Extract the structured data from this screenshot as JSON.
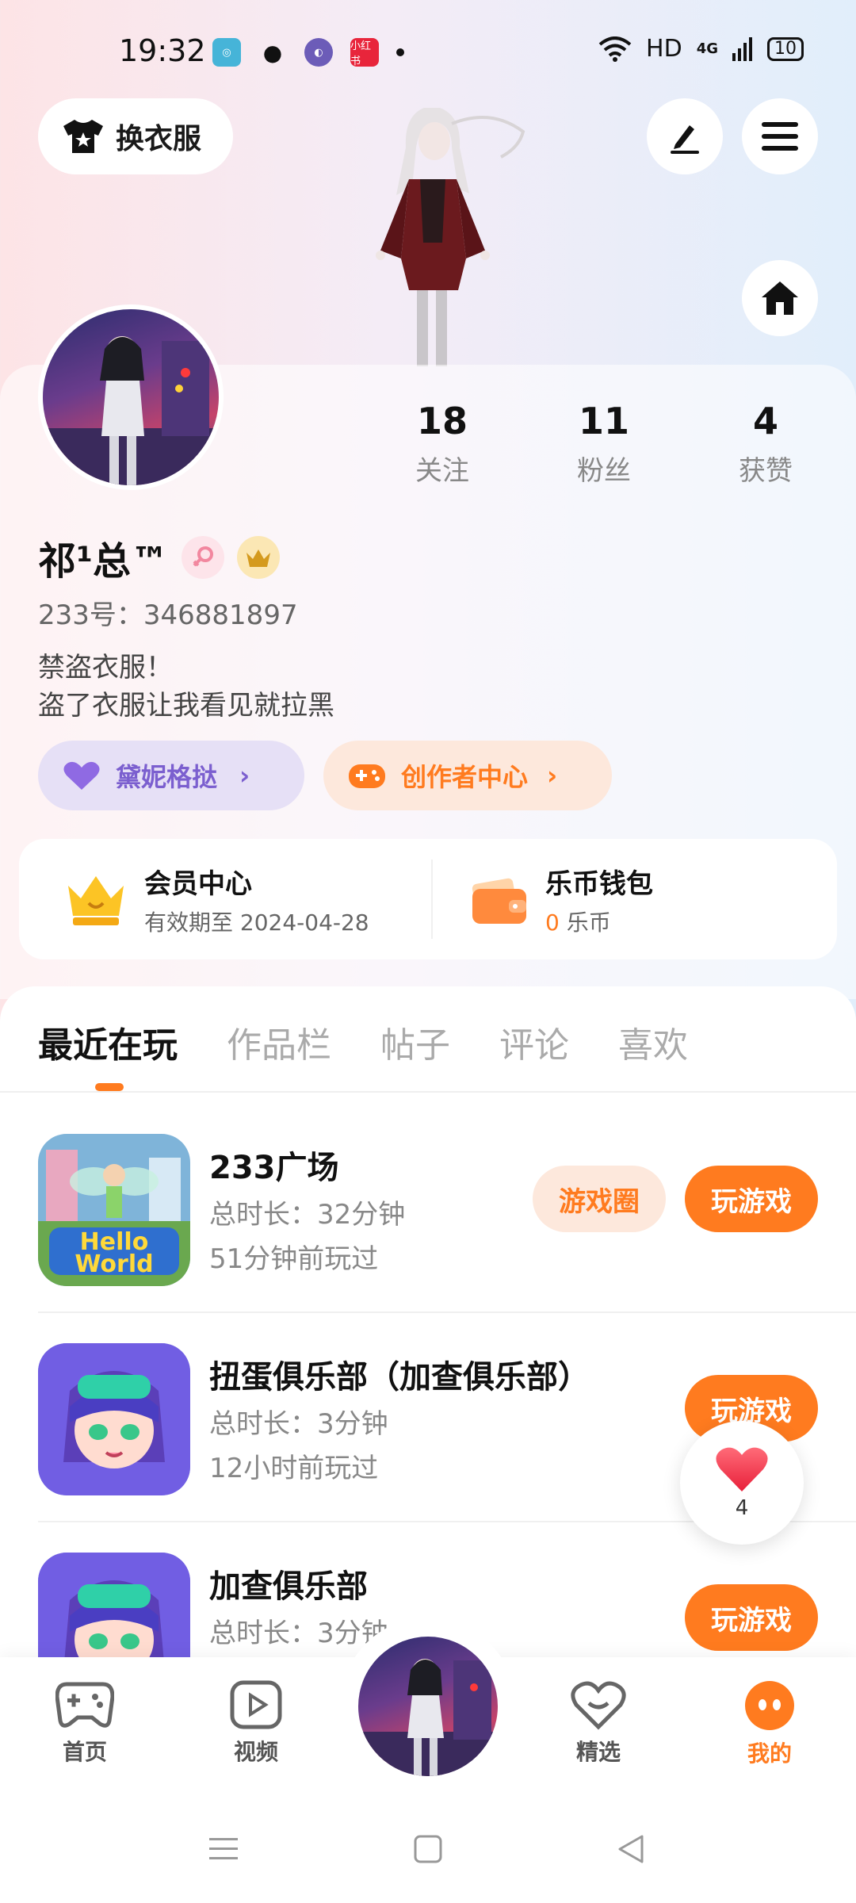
{
  "status_bar": {
    "time": "19:32",
    "app_icon_label": "小红书",
    "network": "HD",
    "signal": "4G",
    "battery": "10"
  },
  "header": {
    "dress_button_label": "换衣服"
  },
  "profile": {
    "stats": [
      {
        "value": "18",
        "label": "关注"
      },
      {
        "value": "11",
        "label": "粉丝"
      },
      {
        "value": "4",
        "label": "获赞"
      }
    ],
    "name": "祁¹总™",
    "uid": "233号：346881897",
    "bio_line1": "禁盗衣服！",
    "bio_line2": "盗了衣服让我看见就拉黑",
    "pill_1": "黛妮格挞",
    "pill_2": "创作者中心"
  },
  "member": {
    "title": "会员中心",
    "subtitle": "有效期至 2024-04-28",
    "wallet_title": "乐币钱包",
    "wallet_value": "0",
    "wallet_unit": "乐币"
  },
  "tabs": [
    "最近在玩",
    "作品栏",
    "帖子",
    "评论",
    "喜欢"
  ],
  "games": [
    {
      "title": "233广场",
      "duration": "总时长：32分钟",
      "last_played": "51分钟前玩过",
      "circle_label": "游戏圈",
      "play_label": "玩游戏",
      "icon_text": "Hello World"
    },
    {
      "title": "扭蛋俱乐部（加查俱乐部）",
      "duration": "总时长：3分钟",
      "last_played": "12小时前玩过",
      "play_label": "玩游戏"
    },
    {
      "title": "加查俱乐部",
      "duration": "总时长：3分钟",
      "play_label": "玩游戏"
    }
  ],
  "like_float": {
    "count": "4"
  },
  "bottom_nav": [
    {
      "label": "首页"
    },
    {
      "label": "视频"
    },
    {
      "label": "精选"
    },
    {
      "label": "我的"
    }
  ],
  "colors": {
    "accent_orange": "#ff7b1f",
    "pill_purple_bg": "#e6e0f6",
    "pill_orange_bg": "#fde8dc"
  }
}
